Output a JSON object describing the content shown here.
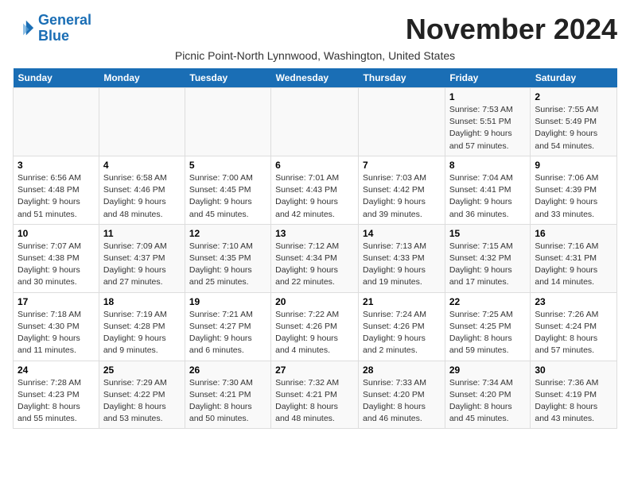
{
  "logo": {
    "line1": "General",
    "line2": "Blue"
  },
  "month_title": "November 2024",
  "subtitle": "Picnic Point-North Lynnwood, Washington, United States",
  "header": {
    "colors": {
      "blue": "#1a6eb5"
    }
  },
  "days_of_week": [
    "Sunday",
    "Monday",
    "Tuesday",
    "Wednesday",
    "Thursday",
    "Friday",
    "Saturday"
  ],
  "weeks": [
    {
      "days": [
        {
          "num": "",
          "info": ""
        },
        {
          "num": "",
          "info": ""
        },
        {
          "num": "",
          "info": ""
        },
        {
          "num": "",
          "info": ""
        },
        {
          "num": "",
          "info": ""
        },
        {
          "num": "1",
          "info": "Sunrise: 7:53 AM\nSunset: 5:51 PM\nDaylight: 9 hours and 57 minutes."
        },
        {
          "num": "2",
          "info": "Sunrise: 7:55 AM\nSunset: 5:49 PM\nDaylight: 9 hours and 54 minutes."
        }
      ]
    },
    {
      "days": [
        {
          "num": "3",
          "info": "Sunrise: 6:56 AM\nSunset: 4:48 PM\nDaylight: 9 hours and 51 minutes."
        },
        {
          "num": "4",
          "info": "Sunrise: 6:58 AM\nSunset: 4:46 PM\nDaylight: 9 hours and 48 minutes."
        },
        {
          "num": "5",
          "info": "Sunrise: 7:00 AM\nSunset: 4:45 PM\nDaylight: 9 hours and 45 minutes."
        },
        {
          "num": "6",
          "info": "Sunrise: 7:01 AM\nSunset: 4:43 PM\nDaylight: 9 hours and 42 minutes."
        },
        {
          "num": "7",
          "info": "Sunrise: 7:03 AM\nSunset: 4:42 PM\nDaylight: 9 hours and 39 minutes."
        },
        {
          "num": "8",
          "info": "Sunrise: 7:04 AM\nSunset: 4:41 PM\nDaylight: 9 hours and 36 minutes."
        },
        {
          "num": "9",
          "info": "Sunrise: 7:06 AM\nSunset: 4:39 PM\nDaylight: 9 hours and 33 minutes."
        }
      ]
    },
    {
      "days": [
        {
          "num": "10",
          "info": "Sunrise: 7:07 AM\nSunset: 4:38 PM\nDaylight: 9 hours and 30 minutes."
        },
        {
          "num": "11",
          "info": "Sunrise: 7:09 AM\nSunset: 4:37 PM\nDaylight: 9 hours and 27 minutes."
        },
        {
          "num": "12",
          "info": "Sunrise: 7:10 AM\nSunset: 4:35 PM\nDaylight: 9 hours and 25 minutes."
        },
        {
          "num": "13",
          "info": "Sunrise: 7:12 AM\nSunset: 4:34 PM\nDaylight: 9 hours and 22 minutes."
        },
        {
          "num": "14",
          "info": "Sunrise: 7:13 AM\nSunset: 4:33 PM\nDaylight: 9 hours and 19 minutes."
        },
        {
          "num": "15",
          "info": "Sunrise: 7:15 AM\nSunset: 4:32 PM\nDaylight: 9 hours and 17 minutes."
        },
        {
          "num": "16",
          "info": "Sunrise: 7:16 AM\nSunset: 4:31 PM\nDaylight: 9 hours and 14 minutes."
        }
      ]
    },
    {
      "days": [
        {
          "num": "17",
          "info": "Sunrise: 7:18 AM\nSunset: 4:30 PM\nDaylight: 9 hours and 11 minutes."
        },
        {
          "num": "18",
          "info": "Sunrise: 7:19 AM\nSunset: 4:28 PM\nDaylight: 9 hours and 9 minutes."
        },
        {
          "num": "19",
          "info": "Sunrise: 7:21 AM\nSunset: 4:27 PM\nDaylight: 9 hours and 6 minutes."
        },
        {
          "num": "20",
          "info": "Sunrise: 7:22 AM\nSunset: 4:26 PM\nDaylight: 9 hours and 4 minutes."
        },
        {
          "num": "21",
          "info": "Sunrise: 7:24 AM\nSunset: 4:26 PM\nDaylight: 9 hours and 2 minutes."
        },
        {
          "num": "22",
          "info": "Sunrise: 7:25 AM\nSunset: 4:25 PM\nDaylight: 8 hours and 59 minutes."
        },
        {
          "num": "23",
          "info": "Sunrise: 7:26 AM\nSunset: 4:24 PM\nDaylight: 8 hours and 57 minutes."
        }
      ]
    },
    {
      "days": [
        {
          "num": "24",
          "info": "Sunrise: 7:28 AM\nSunset: 4:23 PM\nDaylight: 8 hours and 55 minutes."
        },
        {
          "num": "25",
          "info": "Sunrise: 7:29 AM\nSunset: 4:22 PM\nDaylight: 8 hours and 53 minutes."
        },
        {
          "num": "26",
          "info": "Sunrise: 7:30 AM\nSunset: 4:21 PM\nDaylight: 8 hours and 50 minutes."
        },
        {
          "num": "27",
          "info": "Sunrise: 7:32 AM\nSunset: 4:21 PM\nDaylight: 8 hours and 48 minutes."
        },
        {
          "num": "28",
          "info": "Sunrise: 7:33 AM\nSunset: 4:20 PM\nDaylight: 8 hours and 46 minutes."
        },
        {
          "num": "29",
          "info": "Sunrise: 7:34 AM\nSunset: 4:20 PM\nDaylight: 8 hours and 45 minutes."
        },
        {
          "num": "30",
          "info": "Sunrise: 7:36 AM\nSunset: 4:19 PM\nDaylight: 8 hours and 43 minutes."
        }
      ]
    }
  ]
}
